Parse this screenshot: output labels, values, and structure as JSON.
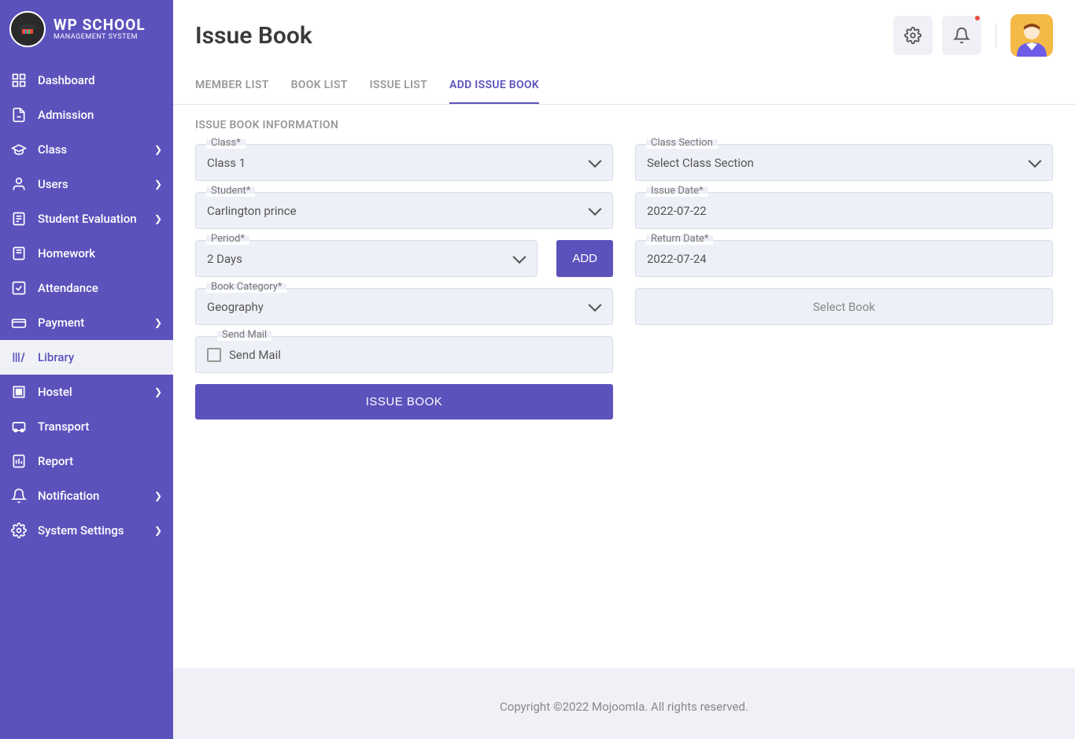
{
  "logo": {
    "title": "WP SCHOOL",
    "subtitle": "MANAGEMENT SYSTEM"
  },
  "sidebar": {
    "items": [
      {
        "label": "Dashboard",
        "icon": "dashboard",
        "hasChildren": false
      },
      {
        "label": "Admission",
        "icon": "admission",
        "hasChildren": false
      },
      {
        "label": "Class",
        "icon": "class",
        "hasChildren": true
      },
      {
        "label": "Users",
        "icon": "users",
        "hasChildren": true
      },
      {
        "label": "Student Evaluation",
        "icon": "evaluation",
        "hasChildren": true
      },
      {
        "label": "Homework",
        "icon": "homework",
        "hasChildren": false
      },
      {
        "label": "Attendance",
        "icon": "attendance",
        "hasChildren": false
      },
      {
        "label": "Payment",
        "icon": "payment",
        "hasChildren": true
      },
      {
        "label": "Library",
        "icon": "library",
        "hasChildren": false,
        "active": true
      },
      {
        "label": "Hostel",
        "icon": "hostel",
        "hasChildren": true
      },
      {
        "label": "Transport",
        "icon": "transport",
        "hasChildren": false
      },
      {
        "label": "Report",
        "icon": "report",
        "hasChildren": false
      },
      {
        "label": "Notification",
        "icon": "notification",
        "hasChildren": true
      },
      {
        "label": "System Settings",
        "icon": "settings",
        "hasChildren": true
      }
    ]
  },
  "page": {
    "title": "Issue Book",
    "tabs": [
      {
        "label": "MEMBER LIST"
      },
      {
        "label": "BOOK LIST"
      },
      {
        "label": "ISSUE LIST"
      },
      {
        "label": "ADD ISSUE BOOK",
        "active": true
      }
    ],
    "sectionTitle": "ISSUE BOOK INFORMATION"
  },
  "form": {
    "class": {
      "label": "Class*",
      "value": "Class 1"
    },
    "classSection": {
      "label": "Class Section",
      "value": "Select Class Section"
    },
    "student": {
      "label": "Student*",
      "value": "Carlington prince"
    },
    "issueDate": {
      "label": "Issue Date*",
      "value": "2022-07-22"
    },
    "period": {
      "label": "Period*",
      "value": "2 Days",
      "addButton": "ADD"
    },
    "returnDate": {
      "label": "Return Date*",
      "value": "2022-07-24"
    },
    "bookCategory": {
      "label": "Book Category*",
      "value": "Geography"
    },
    "selectBook": {
      "value": "Select Book"
    },
    "sendMail": {
      "legend": "Send Mail",
      "label": "Send Mail"
    },
    "submitButton": "ISSUE BOOK"
  },
  "footer": "Copyright ©2022 Mojoomla. All rights reserved."
}
